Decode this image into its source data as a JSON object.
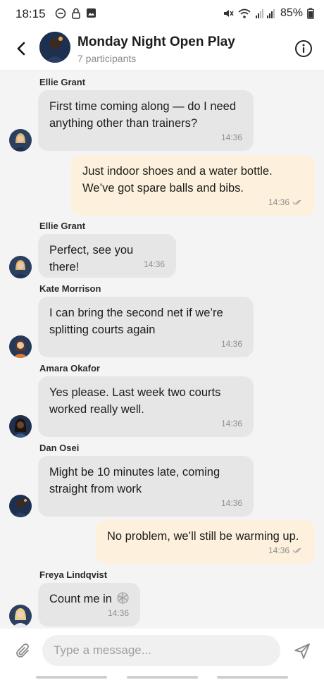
{
  "status": {
    "time": "18:15",
    "battery": "85%"
  },
  "header": {
    "title": "Monday Night Open Play",
    "subtitle": "7 participants"
  },
  "messages": [
    {
      "sender": "Ellie Grant",
      "text": "First time coming along — do I need anything other than trainers?",
      "time": "14:36"
    },
    {
      "text": "Just indoor shoes and a water bottle. We’ve got spare balls and bibs.",
      "time": "14:36"
    },
    {
      "sender": "Ellie Grant",
      "text": "Perfect, see you there!",
      "time": "14:36"
    },
    {
      "sender": "Kate Morrison",
      "text": "I can bring the second net if we’re splitting courts again",
      "time": "14:36"
    },
    {
      "sender": "Amara Okafor",
      "text": "Yes please. Last week two courts worked really well.",
      "time": "14:36"
    },
    {
      "sender": "Dan Osei",
      "text": "Might be 10 minutes late, coming straight from work",
      "time": "14:36"
    },
    {
      "text": "No problem, we’ll still be warming up.",
      "time": "14:36"
    },
    {
      "sender": "Freya Lindqvist",
      "text": "Count me in",
      "time": "14:36"
    }
  ],
  "composer": {
    "placeholder": "Type a message..."
  },
  "colors": {
    "incoming": "#e6e6e6",
    "outgoing": "#fdf0dc",
    "background": "#f4f4f4"
  }
}
